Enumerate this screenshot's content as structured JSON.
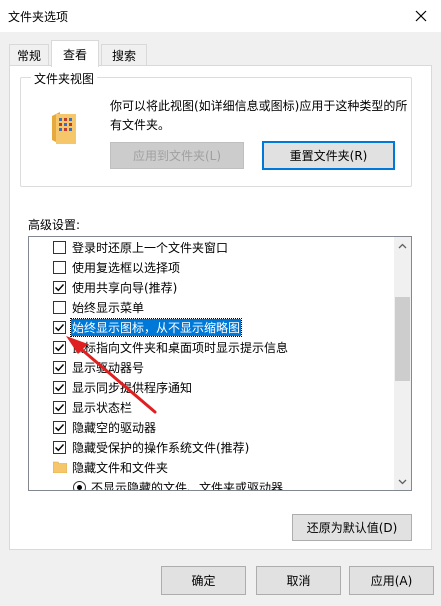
{
  "window": {
    "title": "文件夹选项"
  },
  "tabs": [
    {
      "label": "常规",
      "active": false
    },
    {
      "label": "查看",
      "active": true
    },
    {
      "label": "搜索",
      "active": false
    }
  ],
  "folder_views": {
    "legend": "文件夹视图",
    "description": "你可以将此视图(如详细信息或图标)应用于这种类型的所有文件夹。",
    "apply_button": "应用到文件夹(L)",
    "reset_button": "重置文件夹(R)"
  },
  "advanced": {
    "label": "高级设置:",
    "items": [
      {
        "type": "checkbox",
        "checked": false,
        "label": "登录时还原上一个文件夹窗口"
      },
      {
        "type": "checkbox",
        "checked": false,
        "label": "使用复选框以选择项"
      },
      {
        "type": "checkbox",
        "checked": true,
        "label": "使用共享向导(推荐)"
      },
      {
        "type": "checkbox",
        "checked": false,
        "label": "始终显示菜单"
      },
      {
        "type": "checkbox",
        "checked": true,
        "label": "始终显示图标，从不显示缩略图",
        "selected": true
      },
      {
        "type": "checkbox",
        "checked": true,
        "label": "鼠标指向文件夹和桌面项时显示提示信息"
      },
      {
        "type": "checkbox",
        "checked": true,
        "label": "显示驱动器号"
      },
      {
        "type": "checkbox",
        "checked": true,
        "label": "显示同步提供程序通知"
      },
      {
        "type": "checkbox",
        "checked": true,
        "label": "显示状态栏"
      },
      {
        "type": "checkbox",
        "checked": true,
        "label": "隐藏空的驱动器"
      },
      {
        "type": "checkbox",
        "checked": true,
        "label": "隐藏受保护的操作系统文件(推荐)"
      },
      {
        "type": "folder",
        "label": "隐藏文件和文件夹"
      },
      {
        "type": "radio",
        "checked": true,
        "label": "不显示隐藏的文件、文件夹或驱动器"
      }
    ],
    "restore_defaults": "还原为默认值(D)"
  },
  "footer": {
    "ok": "确定",
    "cancel": "取消",
    "apply": "应用(A)"
  },
  "colors": {
    "accent": "#0078d7",
    "annotation_arrow": "#e02020",
    "folder": "#f5c76a"
  }
}
